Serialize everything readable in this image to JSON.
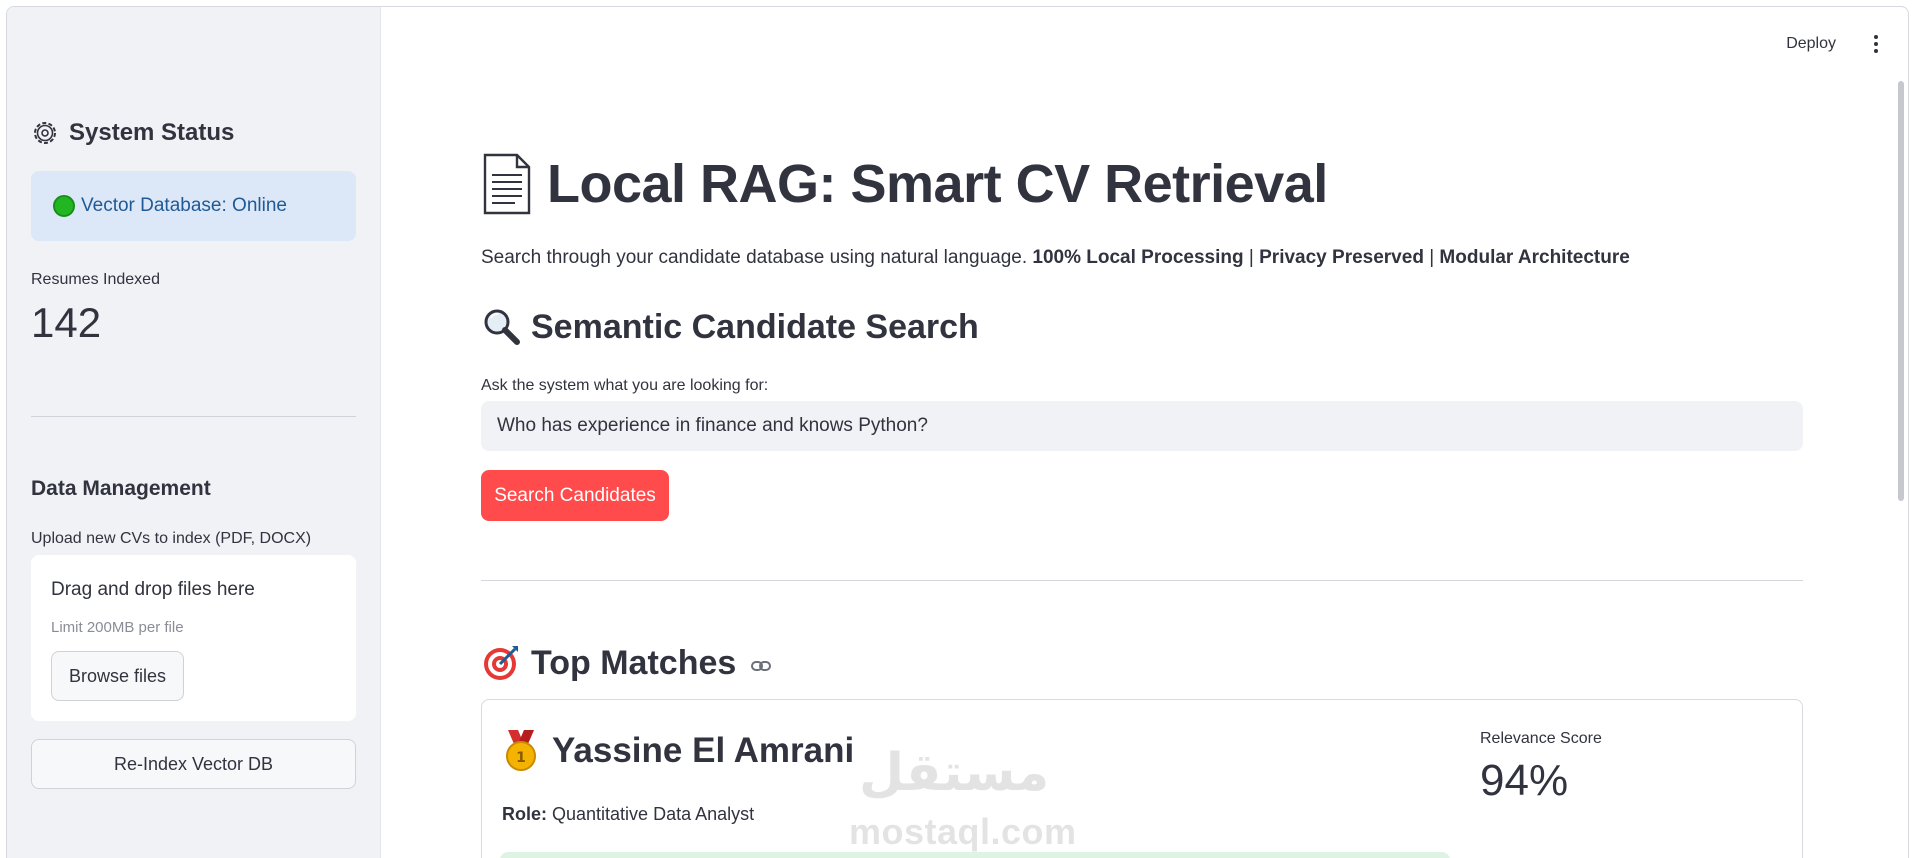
{
  "sidebar": {
    "status_title": "System Status",
    "db_status": "Vector Database: Online",
    "metric_label": "Resumes Indexed",
    "metric_value": "142",
    "data_mgmt_title": "Data Management",
    "upload_label": "Upload new CVs to index (PDF, DOCX)",
    "dropzone_main": "Drag and drop files here",
    "dropzone_sub": "Limit 200MB per file",
    "browse_label": "Browse files",
    "reindex_label": "Re-Index Vector DB"
  },
  "toolbar": {
    "deploy_label": "Deploy"
  },
  "main": {
    "title": "Local RAG: Smart CV Retrieval",
    "intro_plain": "Search through your candidate database using natural language. ",
    "intro_bold_1": "100% Local Processing",
    "intro_sep_1": " | ",
    "intro_bold_2": "Privacy Preserved",
    "intro_sep_2": " | ",
    "intro_bold_3": "Modular Architecture",
    "search_heading": "Semantic Candidate Search",
    "input_label": "Ask the system what you are looking for:",
    "input_value": "Who has experience in finance and knows Python?",
    "search_button": "Search Candidates",
    "matches_heading": "Top Matches"
  },
  "result": {
    "name": "Yassine El Amrani",
    "role_label": "Role:",
    "role_value": "Quantitative Data Analyst",
    "relevance_label": "Relevance Score",
    "relevance_value": "94%"
  },
  "watermark": {
    "arabic": "مستقل",
    "latin": "mostaql.com"
  },
  "colors": {
    "primary_button": "#ff4b4b",
    "sidebar_bg": "#f0f2f6",
    "info_box": "#dce8f7",
    "online_dot": "#22b722"
  },
  "icons": [
    "gear-icon",
    "status-online-icon",
    "document-icon",
    "magnifier-icon",
    "target-icon",
    "link-icon",
    "medal-icon",
    "kebab-menu-icon"
  ]
}
